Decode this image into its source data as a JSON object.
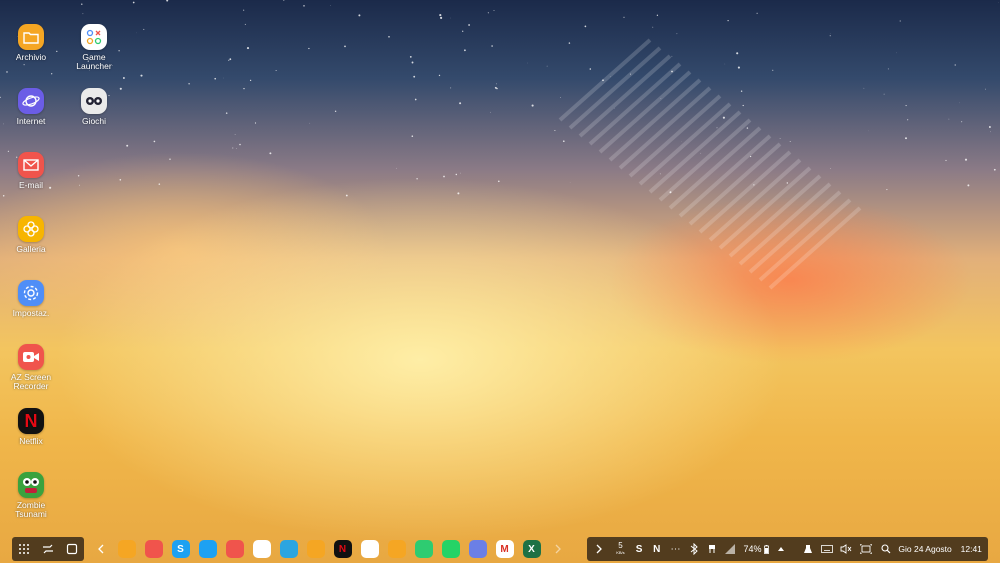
{
  "desktop": {
    "icons": [
      {
        "label": "Archivio",
        "icon": "folder-icon",
        "color": "#f5a623"
      },
      {
        "label": "Internet",
        "icon": "planet-icon",
        "color": "#6b5de6"
      },
      {
        "label": "E-mail",
        "icon": "mail-icon",
        "color": "#f0544c"
      },
      {
        "label": "Galleria",
        "icon": "flower-icon",
        "color": "#f7b500"
      },
      {
        "label": "Impostaz.",
        "icon": "gear-icon",
        "color": "#4f8ef7"
      },
      {
        "label": "AZ Screen Recorder",
        "icon": "video-camera-icon",
        "color": "#f0544c"
      },
      {
        "label": "Netflix",
        "icon": "netflix-icon",
        "color": "#111111"
      },
      {
        "label": "Zombie Tsunami",
        "icon": "zombie-icon",
        "color": "#3aa23e"
      },
      {
        "label": "Game Launcher",
        "icon": "game-launcher-icon",
        "color": "#ffffff"
      },
      {
        "label": "Giochi",
        "icon": "games-icon",
        "color": "#eaeaea"
      }
    ]
  },
  "taskbar": {
    "nav": [
      "apps-grid-icon",
      "recent-apps-icon",
      "home-icon"
    ],
    "apps": [
      {
        "name": "folder-app",
        "color": "#f5a623",
        "glyph": ""
      },
      {
        "name": "mail-app",
        "color": "#f0544c",
        "glyph": ""
      },
      {
        "name": "skype-app",
        "color": "#1da1f2",
        "glyph": "S"
      },
      {
        "name": "twitter-app",
        "color": "#1da1f2",
        "glyph": ""
      },
      {
        "name": "screen-recorder-app",
        "color": "#f0544c",
        "glyph": ""
      },
      {
        "name": "slides-app",
        "color": "#ffffff",
        "glyph": ""
      },
      {
        "name": "telegram-app",
        "color": "#2ca5e0",
        "glyph": ""
      },
      {
        "name": "files-app",
        "color": "#f5a623",
        "glyph": ""
      },
      {
        "name": "netflix-app",
        "color": "#111111",
        "glyph": "N"
      },
      {
        "name": "chrome-app",
        "color": "#ffffff",
        "glyph": ""
      },
      {
        "name": "folder2-app",
        "color": "#f5a623",
        "glyph": ""
      },
      {
        "name": "phone-app",
        "color": "#2ecc71",
        "glyph": ""
      },
      {
        "name": "whatsapp-app",
        "color": "#25d366",
        "glyph": ""
      },
      {
        "name": "camera-app",
        "color": "#6b7fe6",
        "glyph": ""
      },
      {
        "name": "gmail-app",
        "color": "#ffffff",
        "glyph": "M"
      },
      {
        "name": "excel-app",
        "color": "#1e7145",
        "glyph": "X"
      }
    ],
    "status": {
      "notif_count": "5",
      "notif_sub": "KB/s",
      "battery": "74%",
      "date": "Gio 24 Agosto",
      "time": "12:41"
    }
  }
}
